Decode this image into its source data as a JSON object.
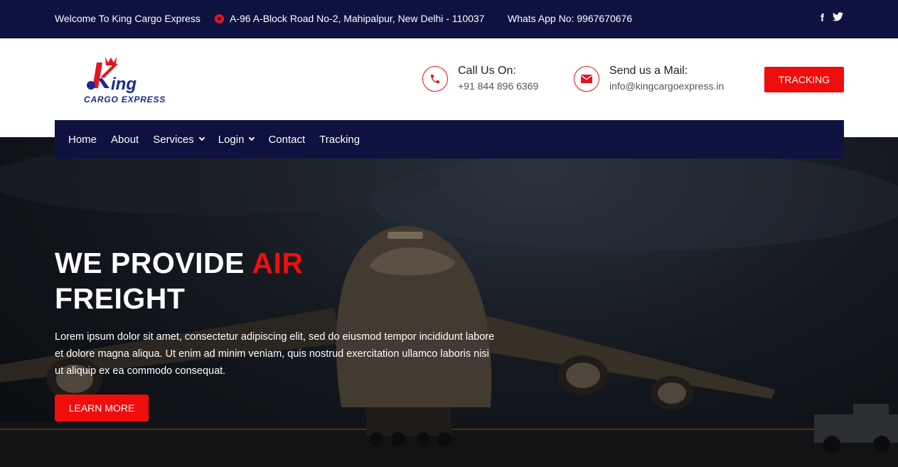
{
  "topbar": {
    "welcome": "Welcome To King Cargo Express",
    "address": "A-96 A-Block Road No-2, Mahipalpur, New Delhi - 110037",
    "whatsapp": "Whats App No: 9967670676",
    "social": {
      "facebook": "f",
      "twitter": "t"
    }
  },
  "logo": {
    "name": "King",
    "tagline": "CARGO EXPRESS"
  },
  "contact": {
    "call_label": "Call Us On:",
    "call_value": "+91 844 896 6369",
    "mail_label": "Send us a Mail:",
    "mail_value": "info@kingcargoexpress.in"
  },
  "tracking_button": "TRACKING",
  "nav": {
    "items": [
      "Home",
      "About",
      "Services",
      "Login",
      "Contact",
      "Tracking"
    ]
  },
  "hero": {
    "title_part1": "WE PROVIDE ",
    "title_highlight": "AIR",
    "title_part2": "FREIGHT",
    "description": "Lorem ipsum dolor sit amet, consectetur adipiscing elit, sed do eiusmod tempor incididunt labore et dolore magna aliqua. Ut enim ad minim veniam, quis nostrud exercitation ullamco laboris nisi ut aliquip ex ea commodo consequat.",
    "button": "LEARN MORE"
  },
  "colors": {
    "navy": "#0e1240",
    "accent_red": "#f00d0d"
  }
}
